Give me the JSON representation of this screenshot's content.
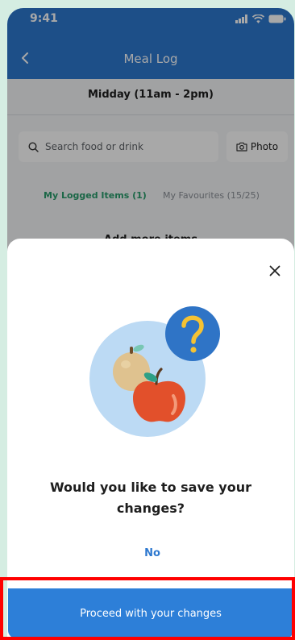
{
  "status_bar": {
    "time": "9:41"
  },
  "nav": {
    "title": "Meal Log"
  },
  "page": {
    "meal_period": "Midday (11am - 2pm)",
    "search_placeholder": "Search food or drink",
    "photo_label": "Photo",
    "tabs": [
      {
        "label": "My Logged Items (1)"
      },
      {
        "label": "My Favourites (15/25)"
      }
    ],
    "add_more": "Add more items"
  },
  "sheet": {
    "question": "Would you like to save your changes?",
    "no_label": "No",
    "proceed_label": "Proceed with your changes"
  },
  "colors": {
    "brand_blue": "#2d78cf",
    "active_tab_green": "#2a9d6c",
    "illustration_circle": "#bcdaf4",
    "question_badge": "#2f74c6",
    "question_mark": "#f5c233"
  },
  "icons": {
    "back": "back-arrow-icon",
    "search": "search-icon",
    "camera": "camera-icon",
    "close": "close-icon",
    "signal": "signal-icon",
    "wifi": "wifi-icon",
    "battery": "battery-icon"
  }
}
